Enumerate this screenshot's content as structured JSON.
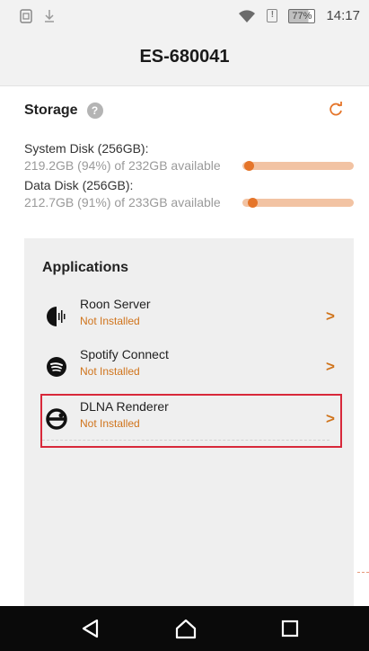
{
  "status_bar": {
    "battery_percent": "77%",
    "time": "14:17",
    "alert_glyph": "!"
  },
  "header": {
    "title": "ES-680041"
  },
  "storage": {
    "title": "Storage",
    "help_glyph": "?",
    "disks": [
      {
        "label": "System Disk (256GB):",
        "available": "219.2GB (94%) of 232GB available",
        "level": 0.06
      },
      {
        "label": "Data Disk (256GB):",
        "available": "212.7GB (91%) of 233GB available",
        "level": 0.09
      }
    ]
  },
  "applications": {
    "title": "Applications",
    "items": [
      {
        "name": "Roon Server",
        "status": "Not Installed",
        "icon": "roon-icon"
      },
      {
        "name": "Spotify Connect",
        "status": "Not Installed",
        "icon": "spotify-icon"
      },
      {
        "name": "DLNA Renderer",
        "status": "Not Installed",
        "icon": "dlna-icon",
        "selected": true
      }
    ],
    "chevron": ">"
  },
  "colors": {
    "accent": "#e5752a",
    "status_text": "#d0741c",
    "highlight_border": "#d8283a"
  }
}
